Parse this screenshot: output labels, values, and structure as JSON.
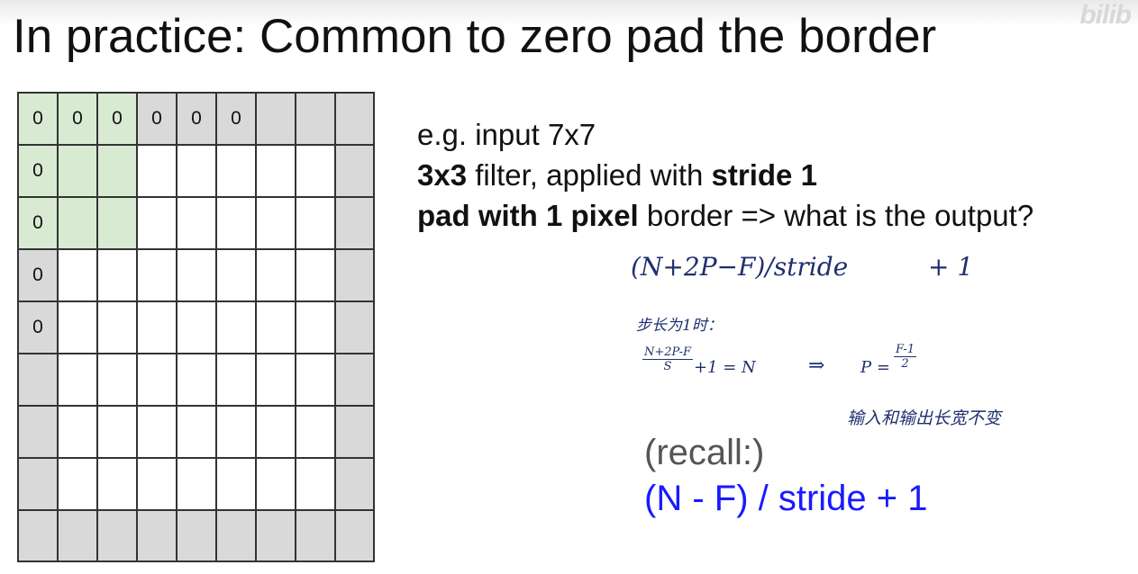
{
  "slide": {
    "title": "In practice: Common to zero pad the border",
    "watermark": "bilib"
  },
  "grid": {
    "rows": 9,
    "cols": 9,
    "zero_label": "0",
    "zeros": [
      [
        0,
        0
      ],
      [
        0,
        1
      ],
      [
        0,
        2
      ],
      [
        0,
        3
      ],
      [
        0,
        4
      ],
      [
        0,
        5
      ],
      [
        1,
        0
      ],
      [
        2,
        0
      ],
      [
        3,
        0
      ],
      [
        4,
        0
      ]
    ],
    "filter_cells": [
      [
        0,
        0
      ],
      [
        0,
        1
      ],
      [
        0,
        2
      ],
      [
        1,
        0
      ],
      [
        1,
        1
      ],
      [
        1,
        2
      ],
      [
        2,
        0
      ],
      [
        2,
        1
      ],
      [
        2,
        2
      ]
    ],
    "pad_color": "#d9d9d9",
    "filter_color": "#d9ead3",
    "inner_color": "#ffffff"
  },
  "text": {
    "line1": "e.g. input 7x7",
    "line2_bold1": "3x3",
    "line2_mid": " filter, applied with ",
    "line2_bold2": "stride 1",
    "line3_bold": "pad with 1 pixel",
    "line3_rest": " border => what is the output?"
  },
  "handwriting": {
    "formula": "(N+2P−F)/stride",
    "plus_one": "+ 1",
    "when_stride_one": "步长为1时：",
    "frac_num": "N+2P-F",
    "frac_den": "S",
    "eq_rest": "+1 = N",
    "arrow": "⇒",
    "p_label": "P =",
    "p_num": "F-1",
    "p_den": "2",
    "note": "输入和输出长宽不变"
  },
  "recall": {
    "label": "(recall:)",
    "formula": "(N - F) / stride + 1",
    "formula_color": "#1a1aff"
  }
}
